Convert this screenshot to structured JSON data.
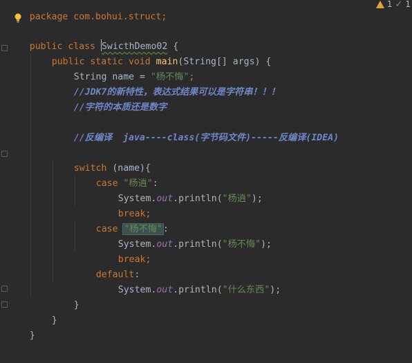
{
  "status": {
    "warnings_count": "1",
    "checks_count": "1"
  },
  "code": {
    "line0": "package com.bohui.struct;",
    "line1_kw": "public class ",
    "line1_name": "SwicthDemo02",
    "line1_tail": " {",
    "line2_kw": "public static void ",
    "line2_method": "main",
    "line2_tail": "(String[] args) {",
    "line3_a": "String name = ",
    "line3_str": "\"杨不悔\"",
    "line3_semi": ";",
    "line4": "//JDK7的新特性，表达式结果可以是字符串！！！",
    "line5": "//字符的本质还是数字",
    "line7": "//反编译  java----class(字节码文件)-----反编译(IDEA)",
    "line9_kw": "switch",
    "line9_tail": " (name){",
    "line10_kw": "case ",
    "line10_str": "\"杨逍\"",
    "line10_tail": ":",
    "line11_a": "System.",
    "line11_field": "out",
    "line11_b": ".println(",
    "line11_str": "\"杨逍\"",
    "line11_c": ");",
    "line12_kw": "break",
    "line12_semi": ";",
    "line13_kw": "case ",
    "line13_str": "\"杨不悔\"",
    "line13_tail": ":",
    "line14_a": "System.",
    "line14_field": "out",
    "line14_b": ".println(",
    "line14_str": "\"杨不悔\"",
    "line14_c": ");",
    "line15_kw": "break",
    "line15_semi": ";",
    "line16_kw": "default",
    "line16_tail": ":",
    "line17_a": "System.",
    "line17_field": "out",
    "line17_b": ".println(",
    "line17_str": "\"什么东西\"",
    "line17_c": ");",
    "line18": "}",
    "line19": "}",
    "line20": "}"
  },
  "colors": {
    "background": "#2b2b2b",
    "keyword": "#cc7832",
    "string": "#6a8759",
    "comment": "#6f86c9",
    "method": "#ffc66d",
    "field": "#9876aa",
    "plain": "#a9b7c6"
  },
  "icons": {
    "warning": "warning-triangle-icon",
    "check": "double-check-icon",
    "bulb": "intention-bulb-icon"
  }
}
